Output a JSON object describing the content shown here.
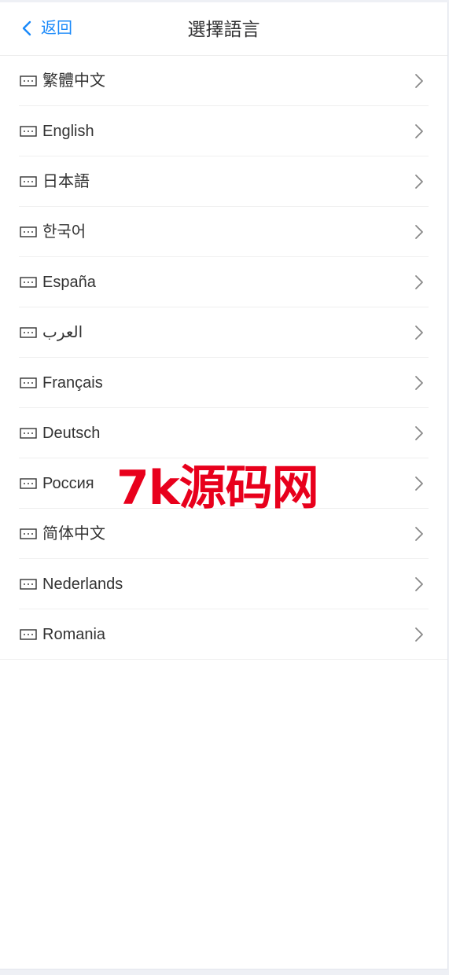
{
  "navbar": {
    "back_label": "返回",
    "title": "選擇語言"
  },
  "languages": [
    {
      "label": "繁體中文"
    },
    {
      "label": "English"
    },
    {
      "label": "日本語"
    },
    {
      "label": "한국어"
    },
    {
      "label": "España"
    },
    {
      "label": "العرب"
    },
    {
      "label": "Français"
    },
    {
      "label": "Deutsch"
    },
    {
      "label": "Россия"
    },
    {
      "label": "简体中文"
    },
    {
      "label": "Nederlands"
    },
    {
      "label": "Romania"
    }
  ],
  "watermark": "7k源码网",
  "icons": {
    "back": "chevron-left-icon",
    "item": "keyboard-icon",
    "arrow": "chevron-right-icon"
  },
  "colors": {
    "accent": "#1989fa",
    "text": "#333333",
    "watermark": "#e8001c"
  }
}
